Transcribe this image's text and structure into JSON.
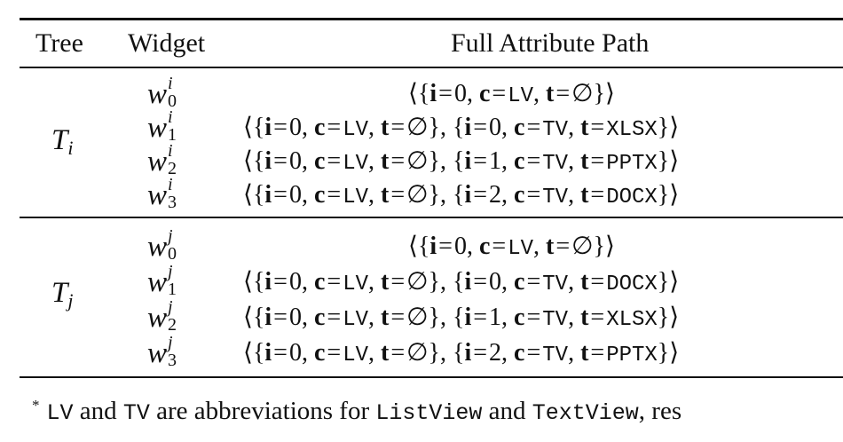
{
  "headers": {
    "tree": "Tree",
    "widget": "Widget",
    "path": "Full Attribute Path"
  },
  "groups": [
    {
      "tree_base": "T",
      "tree_sub": "i",
      "rows": [
        {
          "w": "w",
          "sup": "i",
          "sub": "0",
          "path": [
            [
              {
                "i": "0",
                "c": "LV",
                "t": "∅"
              }
            ]
          ]
        },
        {
          "w": "w",
          "sup": "i",
          "sub": "1"
        },
        {
          "w": "w",
          "sup": "i",
          "sub": "2"
        },
        {
          "w": "w",
          "sup": "i",
          "sub": "3"
        }
      ]
    },
    {
      "tree_base": "T",
      "tree_sub": "j",
      "rows": [
        {
          "w": "w",
          "sup": "j",
          "sub": "0"
        },
        {
          "w": "w",
          "sup": "j",
          "sub": "1"
        },
        {
          "w": "w",
          "sup": "j",
          "sub": "2"
        },
        {
          "w": "w",
          "sup": "j",
          "sub": "3"
        }
      ]
    }
  ],
  "paths": [
    [
      {
        "i": "0",
        "c": "LV",
        "t": "∅"
      }
    ],
    [
      {
        "i": "0",
        "c": "LV",
        "t": "∅"
      },
      {
        "i": "0",
        "c": "TV",
        "t": "XLSX"
      }
    ],
    [
      {
        "i": "0",
        "c": "LV",
        "t": "∅"
      },
      {
        "i": "1",
        "c": "TV",
        "t": "PPTX"
      }
    ],
    [
      {
        "i": "0",
        "c": "LV",
        "t": "∅"
      },
      {
        "i": "2",
        "c": "TV",
        "t": "DOCX"
      }
    ],
    [
      {
        "i": "0",
        "c": "LV",
        "t": "∅"
      }
    ],
    [
      {
        "i": "0",
        "c": "LV",
        "t": "∅"
      },
      {
        "i": "0",
        "c": "TV",
        "t": "DOCX"
      }
    ],
    [
      {
        "i": "0",
        "c": "LV",
        "t": "∅"
      },
      {
        "i": "1",
        "c": "TV",
        "t": "XLSX"
      }
    ],
    [
      {
        "i": "0",
        "c": "LV",
        "t": "∅"
      },
      {
        "i": "2",
        "c": "TV",
        "t": "PPTX"
      }
    ]
  ],
  "footnote": {
    "marker": "*",
    "abbr1": "LV",
    "and1": "and",
    "abbr2": "TV",
    "text1": "are abbreviations for",
    "full1": "ListView",
    "and2": "and",
    "full2": "TextView",
    "tail": ", res"
  }
}
